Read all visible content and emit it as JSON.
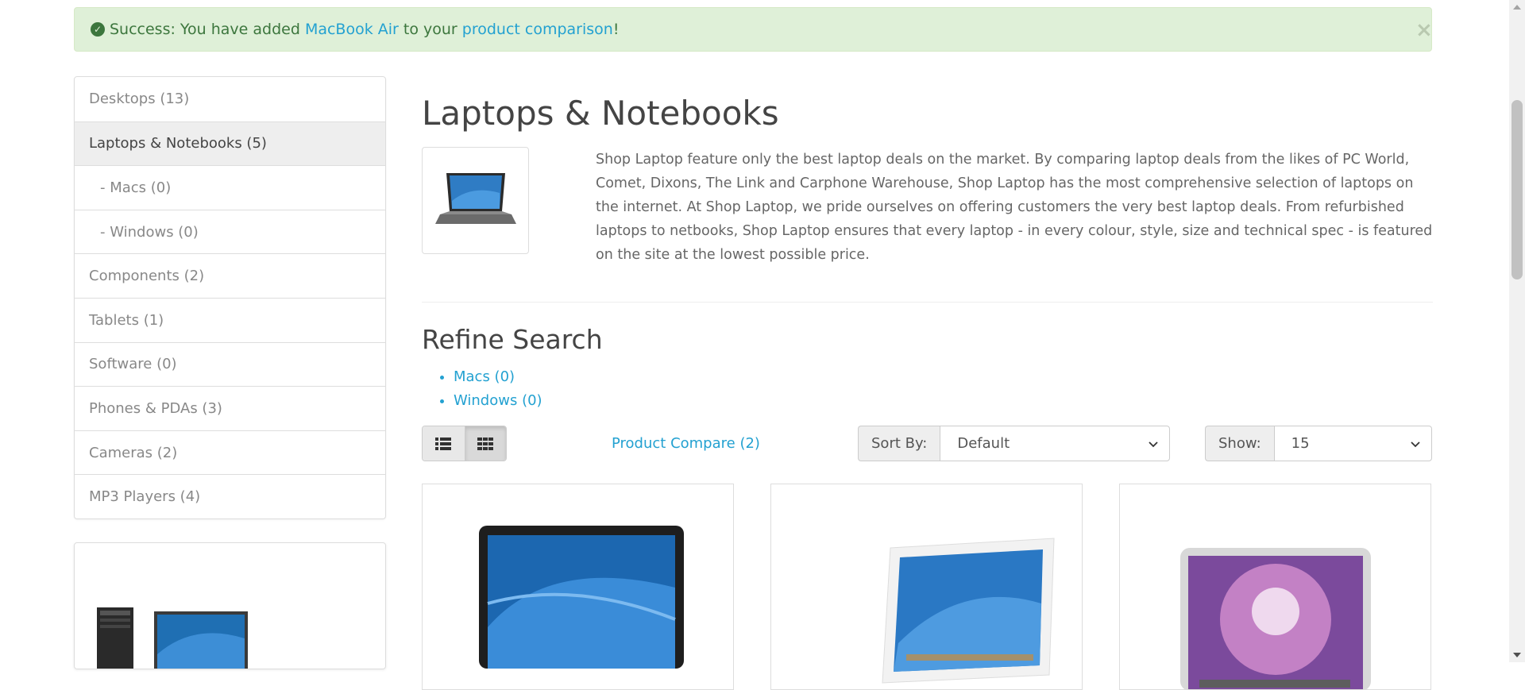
{
  "alert": {
    "prefix": "Success: You have added",
    "product_link": "MacBook Air",
    "middle": "to your",
    "compare_link": "product comparison",
    "suffix": "!",
    "close": "×"
  },
  "sidebar": {
    "items": [
      {
        "label": "Desktops (13)"
      },
      {
        "label": "Laptops & Notebooks (5)"
      },
      {
        "label": "- Macs (0)"
      },
      {
        "label": "- Windows (0)"
      },
      {
        "label": "Components (2)"
      },
      {
        "label": "Tablets (1)"
      },
      {
        "label": "Software (0)"
      },
      {
        "label": "Phones & PDAs (3)"
      },
      {
        "label": "Cameras (2)"
      },
      {
        "label": "MP3 Players (4)"
      }
    ]
  },
  "category": {
    "title": "Laptops & Notebooks",
    "description": "Shop Laptop feature only the best laptop deals on the market. By comparing laptop deals from the likes of PC World, Comet, Dixons, The Link and Carphone Warehouse, Shop Laptop has the most comprehensive selection of laptops on the internet. At Shop Laptop, we pride ourselves on offering customers the very best laptop deals. From refurbished laptops to netbooks, Shop Laptop ensures that every laptop - in every colour, style, size and technical spec - is featured on the site at the lowest possible price."
  },
  "refine": {
    "title": "Refine Search",
    "links": [
      {
        "label": "Macs (0)"
      },
      {
        "label": "Windows (0)"
      }
    ]
  },
  "toolbar": {
    "compare_link": "Product Compare (2)",
    "sort_label": "Sort By:",
    "sort_value": "Default",
    "show_label": "Show:",
    "show_value": "15"
  },
  "icons": {
    "check": "check-circle-icon",
    "list": "list-view-icon",
    "grid": "grid-view-icon",
    "chevron": "chevron-down-icon"
  },
  "colors": {
    "link": "#23a1d1",
    "alert_bg": "#dff0d8",
    "alert_text": "#3c763d",
    "active_item_bg": "#eeeeee"
  }
}
